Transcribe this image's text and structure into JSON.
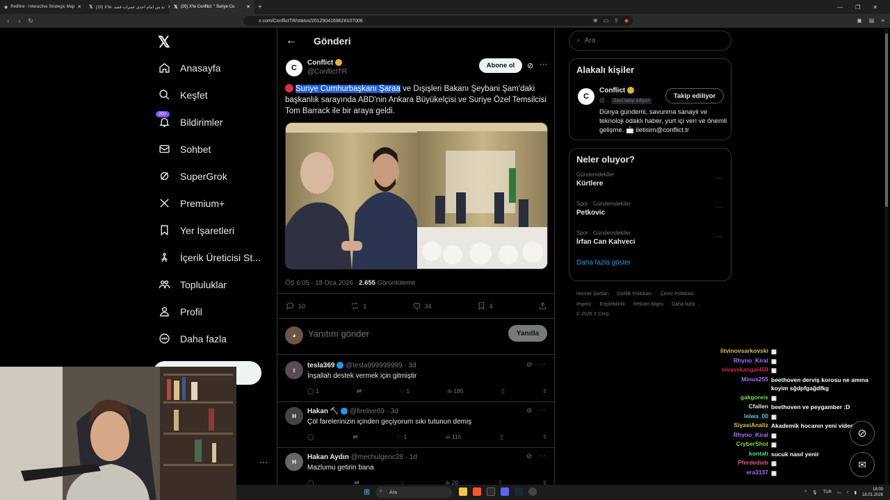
{
  "browser": {
    "tabs": [
      {
        "title": "Redline - Interactive Strategic Map"
      },
      {
        "title": "(19) X'te: بة من امام احدى عمرات قصد"
      },
      {
        "title": "(20) X'te Conflict: \" Suriye Cu"
      }
    ],
    "url": "x.com/ConflictTR/status/2012904169628107006"
  },
  "nav": {
    "items": [
      {
        "label": "Anasayfa",
        "icon": "home-icon"
      },
      {
        "label": "Keşfet",
        "icon": "search-icon"
      },
      {
        "label": "Bildirimler",
        "icon": "bell-icon",
        "badge": "20+"
      },
      {
        "label": "Sohbet",
        "icon": "mail-icon"
      },
      {
        "label": "SuperGrok",
        "icon": "grok-icon"
      },
      {
        "label": "Premium+",
        "icon": "x-icon"
      },
      {
        "label": "Yer İşaretleri",
        "icon": "bookmark-icon"
      },
      {
        "label": "İçerik Üreticisi St...",
        "icon": "creator-icon"
      },
      {
        "label": "Topluluklar",
        "icon": "communities-icon"
      },
      {
        "label": "Profil",
        "icon": "person-icon"
      },
      {
        "label": "Daha fazla",
        "icon": "more-circle-icon"
      }
    ]
  },
  "post": {
    "header": "Gönderi",
    "author_name": "Conflict",
    "author_handle": "@ConflictTR",
    "subscribe_label": "Abone ol",
    "text_highlight": "Suriye Cumhurbaşkanı Şaraa",
    "text_rest": " ve Dışişleri Bakanı Şeybani Şam'daki başkanlık sarayında ABD'nin Ankara Büyükelçisi ve Suriye Özel Temsilcisi Tom Barrack ile bir araya geldi.",
    "time": "ÖS 6:05 · 18 Oca 2026 · ",
    "views_count": "2.655",
    "views_label": " Görüntüleme",
    "replies": "10",
    "reposts": "1",
    "likes": "34",
    "bookmarks": "4",
    "reply_placeholder": "Yanıtını gönder",
    "reply_button": "Yanıtla"
  },
  "replies": [
    {
      "name": "tesla369",
      "handle": "@tesla999999999",
      "time": "· 3d",
      "text": "İnşallah destek vermek için gitmiştir",
      "replies": "1",
      "reposts": "",
      "likes": "1",
      "views": "185"
    },
    {
      "name": "Hakan 🔨",
      "handle": "@firelive69",
      "time": "· 3d",
      "text": "Çöl farelerinizin içinden geçiyorum sıkı tutunun demiş",
      "replies": "",
      "reposts": "",
      "likes": "1",
      "views": "115"
    },
    {
      "name": "Hakan Aydın",
      "handle": "@mechulgenc28",
      "time": "· 1d",
      "text": "Mazlumu getirin bana",
      "replies": "",
      "reposts": "",
      "likes": "",
      "views": "20"
    }
  ],
  "right": {
    "search_placeholder": "Ara",
    "related_title": "Alakalı kişiler",
    "related_name": "Conflict",
    "related_handle": "@...",
    "follows_you": "Seni takip ediyor",
    "following_label": "Takip ediliyor",
    "related_bio": "Dünya gündemi, savunma sanayii ve teknoloji odaklı haber, yurt içi veri ve önemli gelişme. 📩 iletisim@conflict.tr",
    "trends_title": "Neler oluyor?",
    "trends": [
      {
        "category": "Gündemdekiler",
        "title": "Kürtlere"
      },
      {
        "category": "Spor · Gündemdekiler",
        "title": "Petkovic"
      },
      {
        "category": "Spor · Gündemdekiler",
        "title": "İrfan Can Kahveci"
      }
    ],
    "show_more": "Daha fazla göster",
    "footer_row1": [
      "Hizmet Şartları",
      "Gizlilik Politikası",
      "Çerez Politikası"
    ],
    "footer_row2": [
      "Imprint",
      "Erişilebilirlik",
      "Reklam bilgisi",
      "Daha fazla ..."
    ],
    "copyright": "© 2026 X Corp."
  },
  "chat": [
    {
      "name": "litvinovsarkovski",
      "color": "#e0c14a",
      "msg": ""
    },
    {
      "name": "Rhyno_Kiral",
      "color": "#a770ff",
      "msg": ""
    },
    {
      "name": "sivasskangal458",
      "color": "#d4284e",
      "msg": ""
    },
    {
      "name": "Minus255",
      "color": "#a770ff",
      "msg": "beethoven derviş korosu ne amına koyim sğdpfgağdfkg"
    },
    {
      "name": "gakgoreis",
      "color": "#7ddb4a",
      "msg": ""
    },
    {
      "name": "Cfallen",
      "color": "#e6e6e6",
      "msg": "beethoven ve peygamber :D"
    },
    {
      "name": "leiwa_00",
      "color": "#4ad0e0",
      "msg": ""
    },
    {
      "name": "SiyasiAnaliz",
      "color": "#e0c14a",
      "msg": "Akademik hocanın yeni videosu"
    },
    {
      "name": "Rhyno_Kiral",
      "color": "#a770ff",
      "msg": ""
    },
    {
      "name": "CryberShot",
      "color": "#7ddb4a",
      "msg": ""
    },
    {
      "name": "kontah",
      "color": "#4ae08a",
      "msg": "sucuk nasıl yenir"
    },
    {
      "name": "Pferdedieb",
      "color": "#e05a8a",
      "msg": ""
    },
    {
      "name": "era3137",
      "color": "#a770ff",
      "msg": ""
    }
  ],
  "taskbar": {
    "search": "Ara",
    "lang": "TUR",
    "time": "18:09",
    "date": "18.01.2026"
  }
}
